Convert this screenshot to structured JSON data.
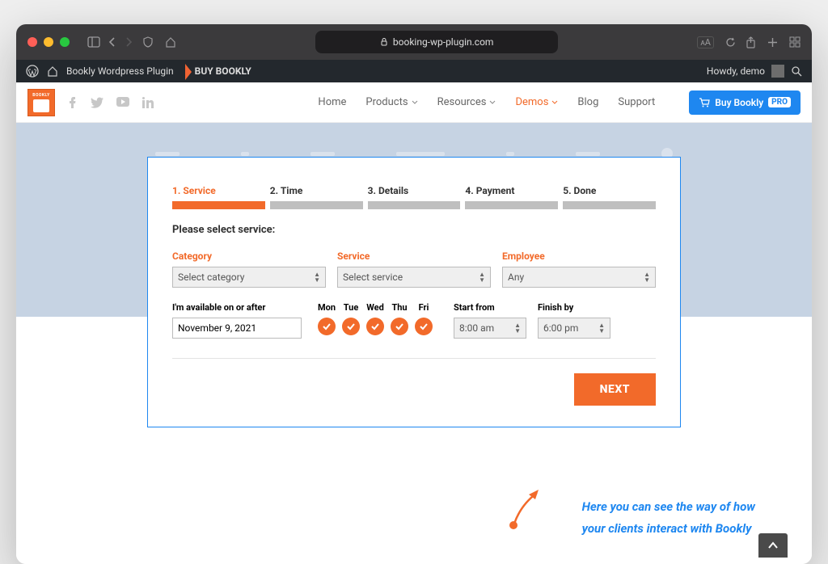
{
  "browser": {
    "url": "booking-wp-plugin.com"
  },
  "wpbar": {
    "site": "Bookly Wordpress Plugin",
    "buy": "BUY BOOKLY",
    "howdy": "Howdy, demo"
  },
  "header": {
    "logo_text": "BOOKLY",
    "menu": {
      "home": "Home",
      "products": "Products",
      "resources": "Resources",
      "demos": "Demos",
      "blog": "Blog",
      "support": "Support"
    },
    "buy_button": "Buy Bookly",
    "buy_badge": "PRO"
  },
  "wizard": {
    "steps": [
      {
        "label": "1. Service",
        "active": true
      },
      {
        "label": "2. Time",
        "active": false
      },
      {
        "label": "3. Details",
        "active": false
      },
      {
        "label": "4. Payment",
        "active": false
      },
      {
        "label": "5. Done",
        "active": false
      }
    ],
    "prompt": "Please select service:",
    "fields": {
      "category": {
        "label": "Category",
        "value": "Select category"
      },
      "service": {
        "label": "Service",
        "value": "Select service"
      },
      "employee": {
        "label": "Employee",
        "value": "Any"
      }
    },
    "availability": {
      "label": "I'm available on or after",
      "date": "November 9, 2021",
      "days": [
        "Mon",
        "Tue",
        "Wed",
        "Thu",
        "Fri"
      ],
      "start": {
        "label": "Start from",
        "value": "8:00 am"
      },
      "finish": {
        "label": "Finish by",
        "value": "6:00 pm"
      }
    },
    "next": "NEXT"
  },
  "caption": {
    "line1": "Here you can see the way of how",
    "line2": "your clients interact with Bookly"
  }
}
